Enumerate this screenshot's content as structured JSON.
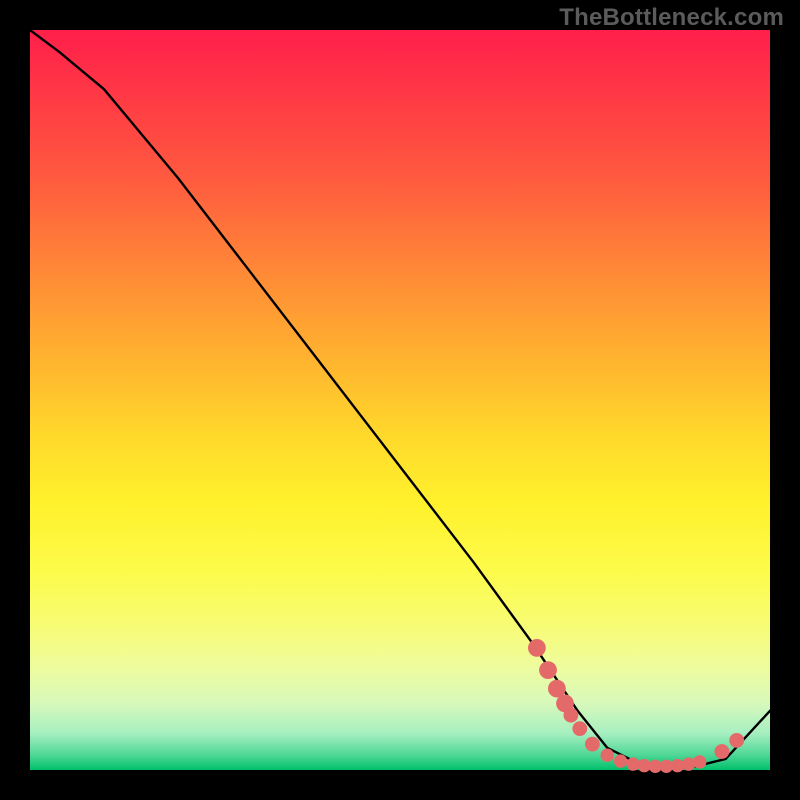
{
  "watermark": "TheBottleneck.com",
  "chart_data": {
    "type": "line",
    "title": "",
    "xlabel": "",
    "ylabel": "",
    "xlim": [
      0,
      100
    ],
    "ylim": [
      0,
      100
    ],
    "series": [
      {
        "name": "curve",
        "x": [
          0,
          4,
          10,
          20,
          30,
          40,
          50,
          60,
          68,
          74,
          78,
          82,
          86,
          90,
          94,
          100
        ],
        "y": [
          100,
          97,
          92,
          80,
          67,
          54,
          41,
          28,
          17,
          8,
          3,
          1,
          0.5,
          0.5,
          1.5,
          8
        ]
      }
    ],
    "markers": [
      {
        "x": 68.5,
        "y": 16.5,
        "r": 1.2
      },
      {
        "x": 70.0,
        "y": 13.5,
        "r": 1.2
      },
      {
        "x": 71.2,
        "y": 11.0,
        "r": 1.2
      },
      {
        "x": 72.3,
        "y": 9.0,
        "r": 1.2
      },
      {
        "x": 73.1,
        "y": 7.4,
        "r": 1.0
      },
      {
        "x": 74.3,
        "y": 5.6,
        "r": 1.0
      },
      {
        "x": 76.0,
        "y": 3.5,
        "r": 1.0
      },
      {
        "x": 78.0,
        "y": 2.0,
        "r": 0.9
      },
      {
        "x": 79.8,
        "y": 1.2,
        "r": 0.9
      },
      {
        "x": 81.5,
        "y": 0.8,
        "r": 0.9
      },
      {
        "x": 83.0,
        "y": 0.6,
        "r": 0.9
      },
      {
        "x": 84.5,
        "y": 0.5,
        "r": 0.9
      },
      {
        "x": 86.0,
        "y": 0.5,
        "r": 0.9
      },
      {
        "x": 87.5,
        "y": 0.6,
        "r": 0.9
      },
      {
        "x": 89.0,
        "y": 0.8,
        "r": 0.9
      },
      {
        "x": 90.5,
        "y": 1.1,
        "r": 0.9
      },
      {
        "x": 93.5,
        "y": 2.5,
        "r": 1.0
      },
      {
        "x": 95.5,
        "y": 4.0,
        "r": 1.0
      }
    ],
    "colors": {
      "curve": "#000000",
      "marker": "#e46a6a"
    }
  }
}
